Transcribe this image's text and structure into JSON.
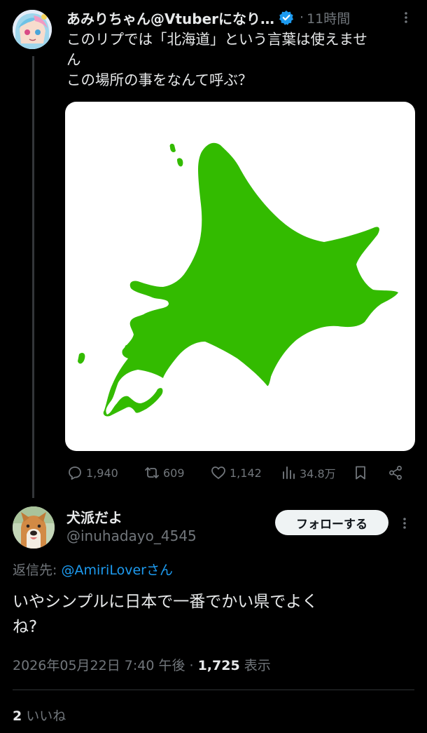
{
  "tweet": {
    "author_name": "あみりちゃん@Vtuberになり…",
    "time_separator": "·",
    "time": "11時間",
    "text_lines": [
      "このリプでは「北海道」という言葉は使えませ",
      "ん",
      "この場所の事をなんて呼ぶ？"
    ],
    "media_fill_color": "#33bb00",
    "stats": {
      "replies": "1,940",
      "retweets": "609",
      "likes": "1,142",
      "views": "34.8万"
    }
  },
  "reply": {
    "author_name": "犬派だよ",
    "handle": "@inuhadayo_4545",
    "follow_label": "フォローする",
    "reply_to_prefix": "返信先: ",
    "reply_to_mention": "@AmiriLoverさん",
    "text_lines": [
      "いやシンプルに日本で一番でかい県でよく",
      "ね?"
    ],
    "datetime": "2026年05月22日 7:40 午後",
    "meta_separator": " · ",
    "views_count": "1,725",
    "views_label": " 表示",
    "likes_count": "2",
    "likes_label": " いいね"
  },
  "colors": {
    "accent": "#1d9bf0",
    "secondary_text": "#71767b",
    "primary_text": "#e7e9ea",
    "background": "#000000"
  },
  "icons": [
    "verified-badge-icon",
    "more-icon",
    "reply-icon",
    "retweet-icon",
    "like-icon",
    "views-icon",
    "bookmark-icon",
    "share-icon"
  ]
}
